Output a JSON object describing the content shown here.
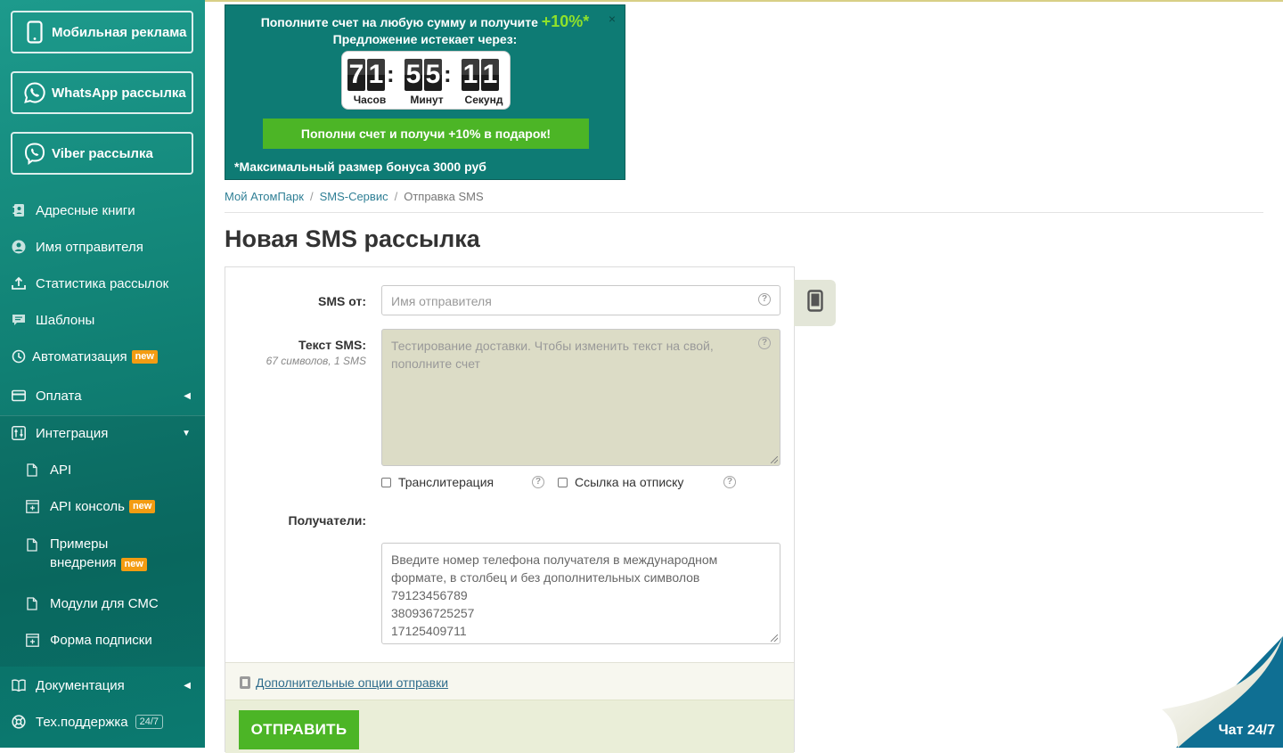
{
  "sidebar": {
    "promo_buttons": [
      {
        "label": "Мобильная реклама",
        "icon": "smartphone-icon"
      },
      {
        "label": "WhatsApp рассылка",
        "icon": "whatsapp-icon"
      },
      {
        "label": "Viber рассылка",
        "icon": "viber-icon"
      }
    ],
    "items": [
      {
        "label": "Адресные книги",
        "icon": "address-book-icon"
      },
      {
        "label": "Имя отправителя",
        "icon": "user-circle-icon"
      },
      {
        "label": "Статистика рассылок",
        "icon": "stats-upload-icon"
      },
      {
        "label": "Шаблоны",
        "icon": "chat-bubble-icon"
      },
      {
        "label": "Автоматизация",
        "icon": "clock-icon",
        "badge": "new"
      },
      {
        "label": "Оплата",
        "icon": "credit-card-icon"
      },
      {
        "label": "Интеграция",
        "icon": "sliders-icon"
      },
      {
        "label": "API",
        "icon": "document-icon"
      },
      {
        "label": "API консоль",
        "icon": "console-plus-icon",
        "badge": "new"
      },
      {
        "label": "Примеры",
        "label2": "внедрения",
        "icon": "document-icon",
        "badge": "new"
      },
      {
        "label": "Модули для СМС",
        "icon": "document-icon"
      },
      {
        "label": "Форма подписки",
        "icon": "form-plus-icon"
      },
      {
        "label": "Документация",
        "icon": "book-icon"
      },
      {
        "label": "Тех.поддержка",
        "icon": "lifebuoy-icon",
        "badge": "24/7"
      }
    ]
  },
  "banner": {
    "line1": "Пополните счет на любую сумму и получите",
    "line1_bonus": "+10%*",
    "line2": "Предложение истекает через:",
    "timer": {
      "hours": "71",
      "minutes": "55",
      "seconds": "11",
      "hours_label": "Часов",
      "minutes_label": "Минут",
      "seconds_label": "Секунд"
    },
    "cta": "Пополни счет и получи +10% в подарок!",
    "note": "*Максимальный размер бонуса 3000 руб",
    "close": "×"
  },
  "breadcrumb": {
    "items": [
      "Мой АтомПарк",
      "SMS-Сервис",
      "Отправка SMS"
    ],
    "separator": "/"
  },
  "page_title": "Новая SMS рассылка",
  "form": {
    "sender_label": "SMS от:",
    "sender_placeholder": "Имя отправителя",
    "text_label": "Текст SMS:",
    "text_stats": "67 символов, 1 SMS",
    "text_value": "Тестирование доставки. Чтобы изменить текст на свой, пополните счет",
    "transliteration_label": "Транслитерация",
    "unsubscribe_label": "Ссылка на отписку",
    "recipients_label": "Получатели:",
    "recipients_placeholder_lines": [
      "Введите номер телефона получателя в международном",
      "формате, в столбец и без дополнительных символов",
      "79123456789",
      "380936725257",
      "17125409711"
    ],
    "extra_options_link": "Дополнительные опции отправки",
    "send_button": "ОТПРАВИТЬ"
  },
  "chat": {
    "label": "Чат 24/7"
  },
  "colors": {
    "sidebar": "#128477",
    "accent_green": "#4cb526",
    "banner_bg": "#0e7b74",
    "badge_orange": "#f39c12",
    "link": "#2f7f95"
  }
}
